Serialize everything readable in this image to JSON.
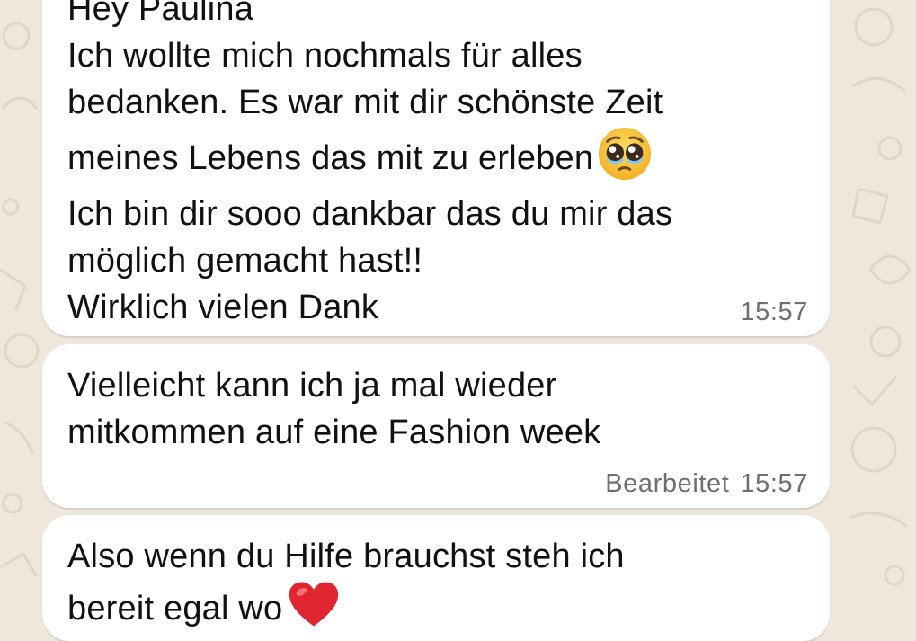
{
  "chat": {
    "messages": [
      {
        "lines": [
          "Hey Paulina",
          "Ich wollte mich nochmals für alles",
          "bedanken. Es war mit dir schönste Zeit",
          "meines Lebens das mit zu erleben",
          "Ich bin dir sooo dankbar das du mir das",
          "möglich gemacht hast!!",
          "Wirklich vielen Dank"
        ],
        "time": "15:57",
        "emoji": "pleading-face-icon"
      },
      {
        "lines": [
          "Vielleicht kann ich ja mal wieder",
          "mitkommen auf eine Fashion week"
        ],
        "edited_label": "Bearbeitet",
        "time": "15:57"
      },
      {
        "lines": [
          "Also wenn du Hilfe brauchst steh ich",
          "bereit egal wo"
        ],
        "emoji": "red-heart-icon"
      }
    ]
  },
  "colors": {
    "wallpaper": "#efe7dc",
    "bubble": "#ffffff",
    "text": "#111111",
    "meta": "#6f6f6f",
    "heart": "#e0262e",
    "emoji_face": "#f6c744"
  }
}
